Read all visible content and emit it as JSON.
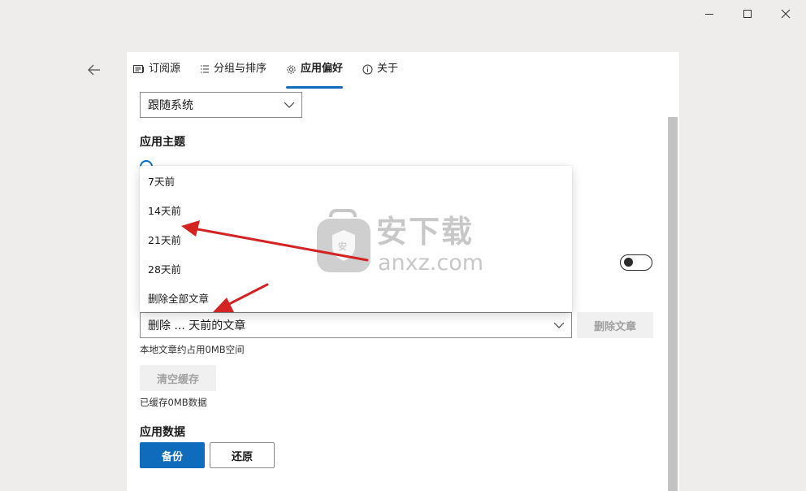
{
  "tabs": [
    {
      "label": "订阅源",
      "icon": "feed-icon"
    },
    {
      "label": "分组与排序",
      "icon": "list-icon"
    },
    {
      "label": "应用偏好",
      "icon": "gear-icon"
    },
    {
      "label": "关于",
      "icon": "info-icon"
    }
  ],
  "language_select": {
    "value": "跟随系统"
  },
  "theme": {
    "title": "应用主题"
  },
  "delete_dropdown": {
    "options": [
      "7天前",
      "14天前",
      "21天前",
      "28天前",
      "删除全部文章"
    ]
  },
  "delete_select": {
    "value": "删除 ... 天前的文章"
  },
  "delete_button": {
    "label": "删除文章"
  },
  "storage": {
    "text": "本地文章约占用0MB空间"
  },
  "clear_cache_button": {
    "label": "清空缓存"
  },
  "cache": {
    "text": "已缓存0MB数据"
  },
  "app_data": {
    "title": "应用数据",
    "backup_label": "备份",
    "restore_label": "还原"
  },
  "watermark": {
    "cn": "安下载",
    "url": "anxz.com"
  },
  "colors": {
    "accent": "#0f6cbd",
    "background": "#eeedeb",
    "annotation_arrow": "#d42323"
  }
}
